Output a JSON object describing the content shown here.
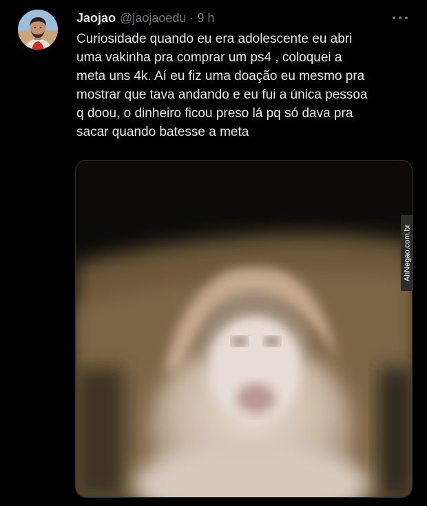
{
  "tweet": {
    "author": {
      "display_name": "Jaojao",
      "handle": "@jaojaoedu",
      "separator": "·",
      "time": "9 h"
    },
    "text_lines": [
      "Curiosidade quando eu era adolescente eu abri",
      "uma vakinha pra comprar um ps4 , coloquei a",
      "meta uns 4k. Aí eu fiz uma doação eu mesmo pra",
      "mostrar que tava andando e eu fui a única pessoa",
      "q doou, o dinheiro ficou preso lá pq só dava pra",
      "sacar quando batesse a meta"
    ],
    "media": {
      "description_icon": "blurry-monkey-photo"
    }
  },
  "watermark": {
    "text": "AhNegao.com.br"
  },
  "theme": {
    "background": "#000000",
    "text_primary": "#e7e9ea",
    "text_secondary": "#71767b"
  }
}
